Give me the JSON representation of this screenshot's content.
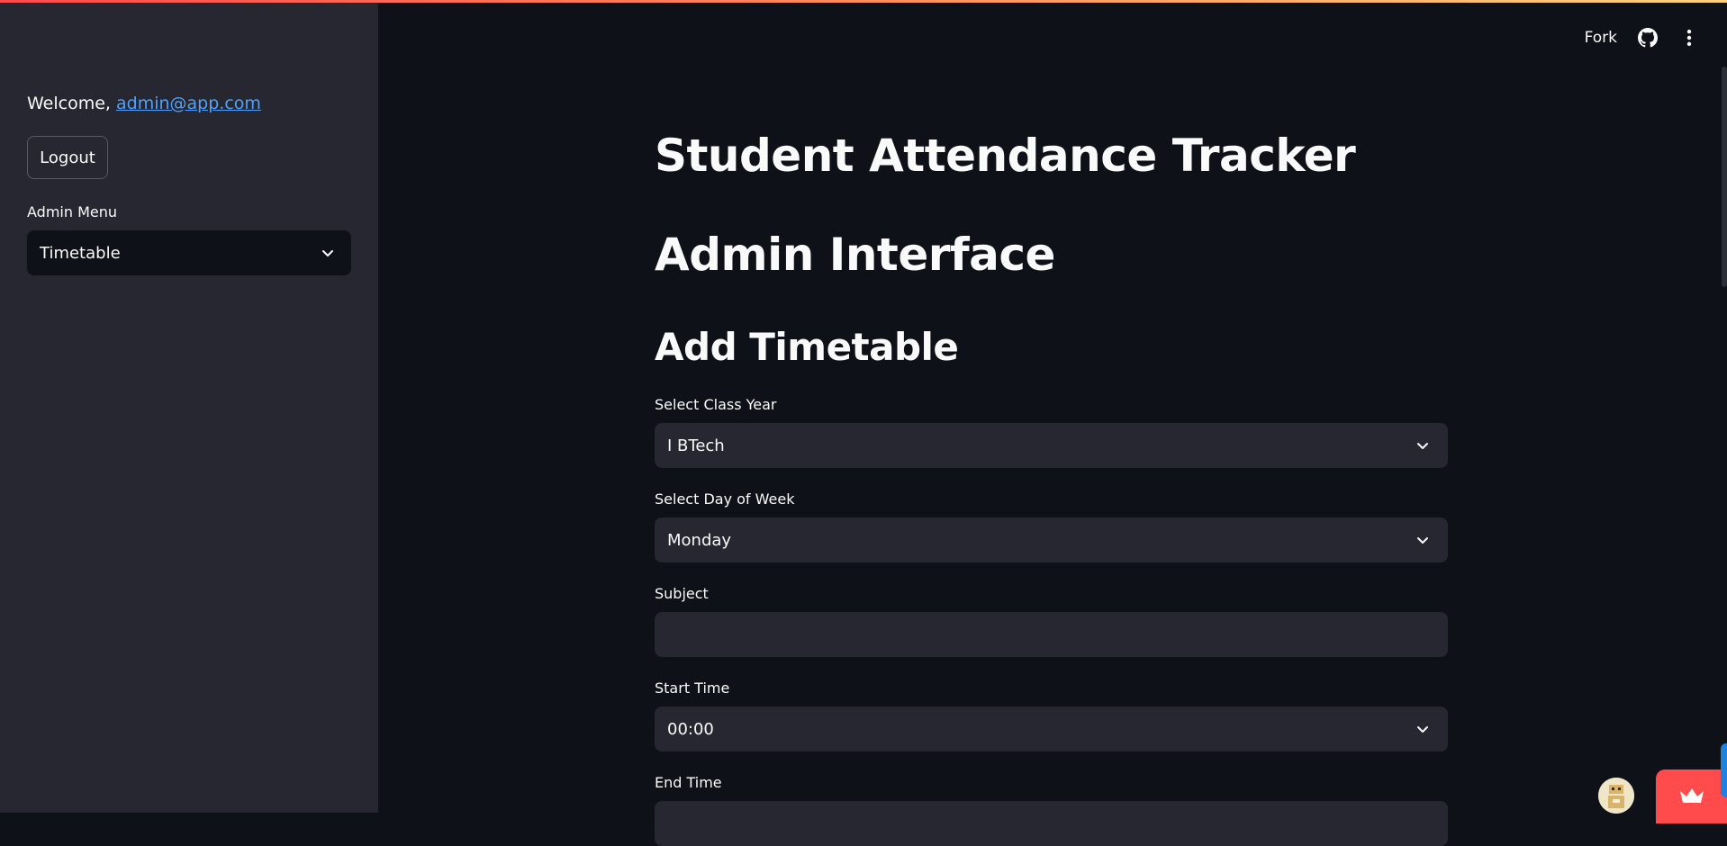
{
  "sidebar": {
    "welcome_prefix": "Welcome, ",
    "welcome_email": "admin@app.com",
    "logout_label": "Logout",
    "menu_label": "Admin Menu",
    "menu_selected": "Timetable"
  },
  "header": {
    "fork_label": "Fork",
    "icons": [
      "github-icon",
      "more-vertical-icon"
    ]
  },
  "main": {
    "title": "Student Attendance Tracker",
    "subtitle": "Admin Interface",
    "section_title": "Add Timetable",
    "fields": {
      "class_year": {
        "label": "Select Class Year",
        "value": "I BTech"
      },
      "day_of_week": {
        "label": "Select Day of Week",
        "value": "Monday"
      },
      "subject": {
        "label": "Subject",
        "value": ""
      },
      "start_time": {
        "label": "Start Time",
        "value": "00:00"
      },
      "end_time": {
        "label": "End Time"
      }
    }
  },
  "colors": {
    "background": "#0e1117",
    "sidebar": "#262730",
    "input": "#262730",
    "link": "#4ea1ff",
    "accent": "#ff4b4b"
  }
}
